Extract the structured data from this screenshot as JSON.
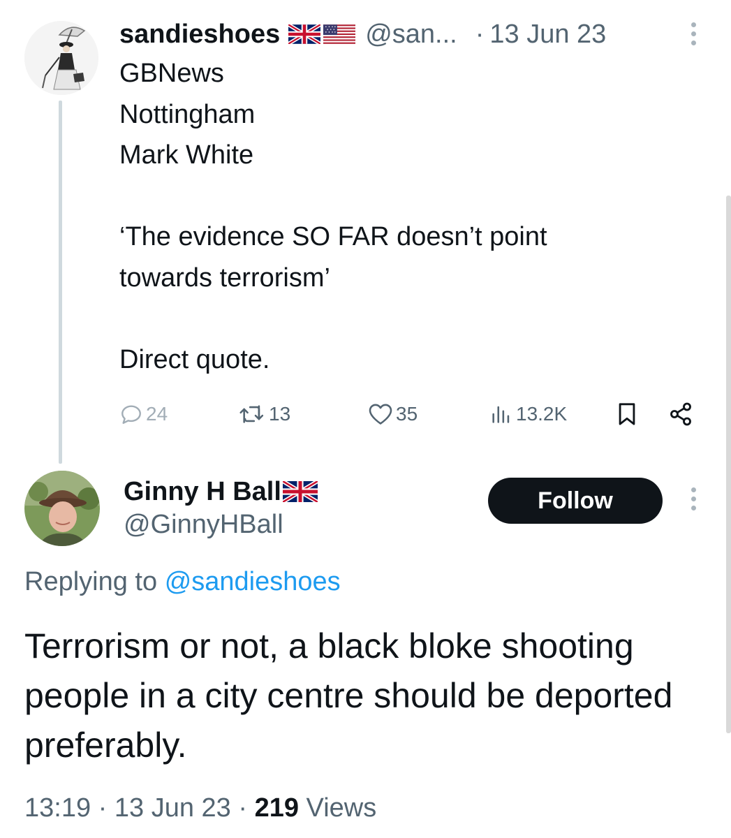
{
  "parent_tweet": {
    "author_name": "sandieshoes",
    "author_flags": [
      "uk-flag-icon",
      "us-flag-icon"
    ],
    "handle": "@san...",
    "separator": "·",
    "date": "13 Jun 23",
    "body_lines": [
      "GBNews",
      "Nottingham",
      "Mark White",
      "",
      "‘The evidence SO FAR doesn’t point",
      "towards terrorism’",
      "",
      "Direct quote."
    ],
    "actions": {
      "replies": "24",
      "retweets": "13",
      "likes": "35",
      "views": "13.2K"
    }
  },
  "reply_tweet": {
    "author_name": "Ginny H Ball",
    "author_flags": [
      "uk-flag-icon"
    ],
    "handle": "@GinnyHBall",
    "follow_label": "Follow",
    "replying_prefix": "Replying to",
    "replying_to": "@sandieshoes",
    "body": "Terrorism or not, a black bloke shooting people in a city centre should be deported preferably.",
    "time": "13:19",
    "separator": "·",
    "date": "13 Jun 23",
    "views_count": "219",
    "views_label": "Views"
  },
  "colors": {
    "text_primary": "#0f1419",
    "text_secondary": "#536471",
    "link": "#1d9bf0",
    "button_bg": "#0f1419",
    "thread_line": "#cfd9de"
  }
}
